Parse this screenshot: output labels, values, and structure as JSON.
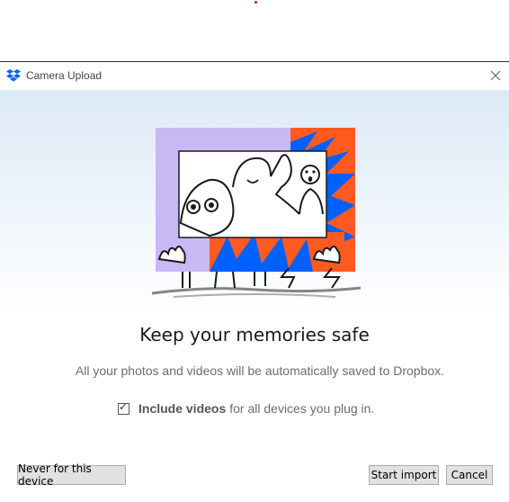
{
  "window": {
    "title": "Camera Upload"
  },
  "icons": {
    "app": "dropbox-icon",
    "close": "close-icon",
    "check": "checkmark-icon"
  },
  "main": {
    "headline": "Keep your memories safe",
    "subtext": "All your photos and videos will be automatically saved to Dropbox.",
    "include_videos_bold": "Include videos",
    "include_videos_rest": "for all devices you plug in.",
    "include_videos_checked": true
  },
  "buttons": {
    "never": "Never for this device",
    "start": "Start import",
    "cancel": "Cancel"
  },
  "colors": {
    "brand_blue": "#0061fe",
    "orange": "#ff5a1f",
    "lavender": "#c8b9f5",
    "accent_red": "#c8102e"
  }
}
